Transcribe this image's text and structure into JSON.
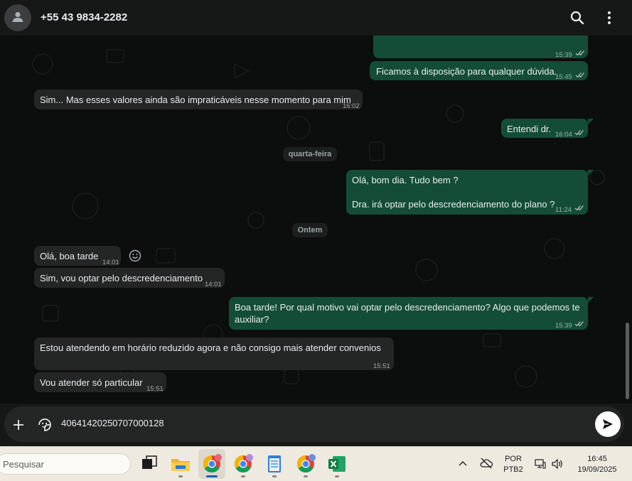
{
  "header": {
    "contact": "+55 43 9834-2282",
    "icons": [
      "search-icon",
      "menu-dots-icon"
    ]
  },
  "messages": {
    "m1": {
      "time": "15:39"
    },
    "m2": {
      "text": "Ficamos à disposição para qualquer dúvida.",
      "time": "15:45"
    },
    "m3": {
      "text": "Sim... Mas esses valores ainda são impraticáveis nesse momento para mim",
      "time": "16:02"
    },
    "m4": {
      "text": "Entendi dr.",
      "time": "16:04"
    },
    "date1": "quarta-feira",
    "m5": {
      "line1": "Olá, bom dia. Tudo bem ?",
      "line2": "Dra. irá optar pelo descredenciamento do plano ?",
      "time": "11:24"
    },
    "date2": "Ontem",
    "m6": {
      "text": "Olá, boa tarde",
      "time": "14:01"
    },
    "m7": {
      "text": "Sim, vou optar pelo descredenciamento",
      "time": "14:01"
    },
    "m8": {
      "line1": "Boa tarde! Por qual motivo vai optar pelo descredenciamento? Algo que podemos te",
      "line2": "auxiliar?",
      "time": "15:39"
    },
    "m9": {
      "text": "Estou atendendo em horário reduzido agora e não consigo mais atender convenios",
      "time": "15:51"
    },
    "m10": {
      "text": "Vou atender só particular",
      "time": "15:51"
    }
  },
  "composer": {
    "value": "40641420250707000128"
  },
  "taskbar": {
    "search_placeholder": "Pesquisar",
    "lang_line1": "POR",
    "lang_line2": "PTB2",
    "time": "16:45",
    "date": "19/09/2025"
  },
  "colors": {
    "outgoing": "#144d37",
    "incoming": "#242626",
    "chat_bg": "#0c0d0d",
    "header_bg": "#161717"
  }
}
